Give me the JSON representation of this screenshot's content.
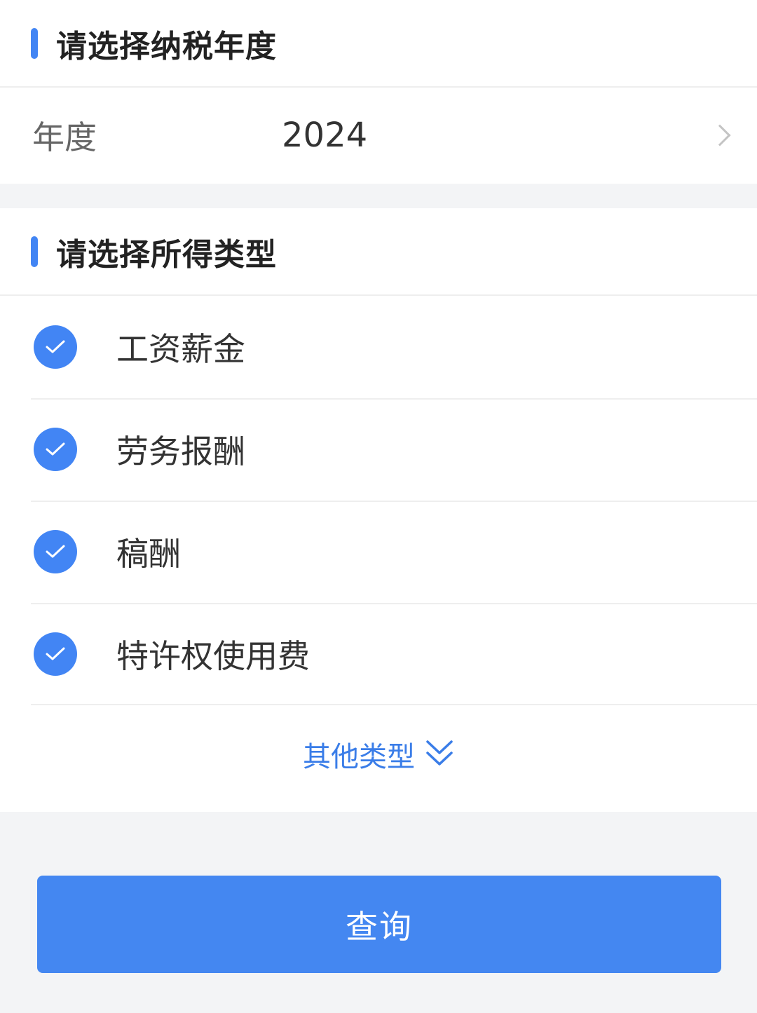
{
  "year_section": {
    "title": "请选择纳税年度",
    "row_label": "年度",
    "row_value": "2024"
  },
  "income_section": {
    "title": "请选择所得类型",
    "items": [
      {
        "label": "工资薪金",
        "checked": true
      },
      {
        "label": "劳务报酬",
        "checked": true
      },
      {
        "label": "稿酬",
        "checked": true
      },
      {
        "label": "特许权使用费",
        "checked": true
      }
    ],
    "more_label": "其他类型"
  },
  "query_button_label": "查询",
  "colors": {
    "accent": "#4285f4",
    "link": "#3a7de8",
    "background": "#f3f4f6"
  }
}
